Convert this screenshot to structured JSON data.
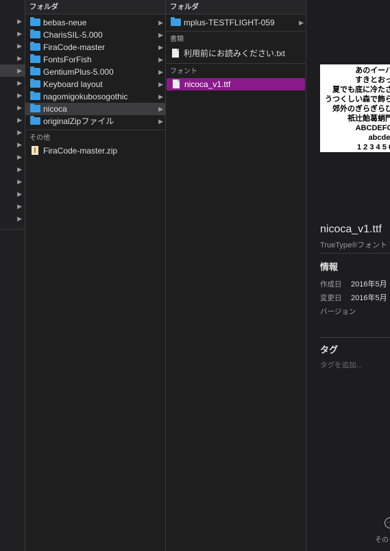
{
  "col1": {
    "header": "フォルダ",
    "folders": [
      {
        "label": "bebas-neue",
        "selected": false
      },
      {
        "label": "CharisSIL-5.000",
        "selected": false
      },
      {
        "label": "FiraCode-master",
        "selected": false
      },
      {
        "label": "FontsForFish",
        "selected": false
      },
      {
        "label": "GentiumPlus-5.000",
        "selected": false
      },
      {
        "label": "Keyboard layout",
        "selected": false
      },
      {
        "label": "nagomigokubosogothic",
        "selected": false
      },
      {
        "label": "nicoca",
        "selected": true
      },
      {
        "label": "originalZipファイル",
        "selected": false
      }
    ],
    "other_header": "その他",
    "other_files": [
      {
        "label": "FiraCode-master.zip",
        "icon": "zip-file-icon"
      }
    ]
  },
  "col2": {
    "header": "フォルダ",
    "folders": [
      {
        "label": "mplus-TESTFLIGHT-059"
      }
    ],
    "docs_header": "書類",
    "docs": [
      {
        "label": "利用前にお読みください.txt"
      }
    ],
    "fonts_header": "フォント",
    "fonts": [
      {
        "label": "nicoca_v1.ttf",
        "highlighted": true
      }
    ]
  },
  "preview": {
    "sample_lines": [
      "あのイーハ",
      "すきとおっ",
      "夏でも底に冷たさ",
      "うつくしい森で飾ら",
      "郊外のぎらぎらひ",
      "祇辻飴葛蛸門",
      "ABCDEFG",
      "abcdef",
      "1 2 3 4 5 6"
    ],
    "file_name": "nicoca_v1.ttf",
    "kind": "TrueType®フォント",
    "info_header": "情報",
    "created_label": "作成日",
    "created_value": "2016年5月",
    "modified_label": "変更日",
    "modified_value": "2016年5月",
    "version_label": "バージョン",
    "tags_header": "タグ",
    "tags_placeholder": "タグを追加...",
    "more_label": "その"
  },
  "colors": {
    "accent_highlight": "#8a1a8a",
    "folder_blue": "#3a9ee4",
    "selection_gray": "#3d3d3f"
  }
}
